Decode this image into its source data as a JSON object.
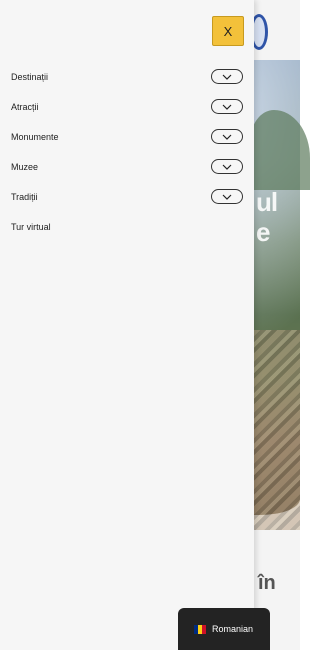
{
  "drawer": {
    "close_label": "X",
    "menu": [
      {
        "label": "Destinații",
        "expandable": true
      },
      {
        "label": "Atracții",
        "expandable": true
      },
      {
        "label": "Monumente",
        "expandable": true
      },
      {
        "label": "Muzee",
        "expandable": true
      },
      {
        "label": "Tradiții",
        "expandable": true
      },
      {
        "label": "Tur virtual",
        "expandable": false
      }
    ]
  },
  "background": {
    "hero_lines": [
      "ul",
      "e"
    ],
    "section_heading_fragment": "în"
  },
  "language_selector": {
    "label": "Romanian",
    "flag_colors": [
      "#002B7F",
      "#FCD116",
      "#CE1126"
    ]
  }
}
